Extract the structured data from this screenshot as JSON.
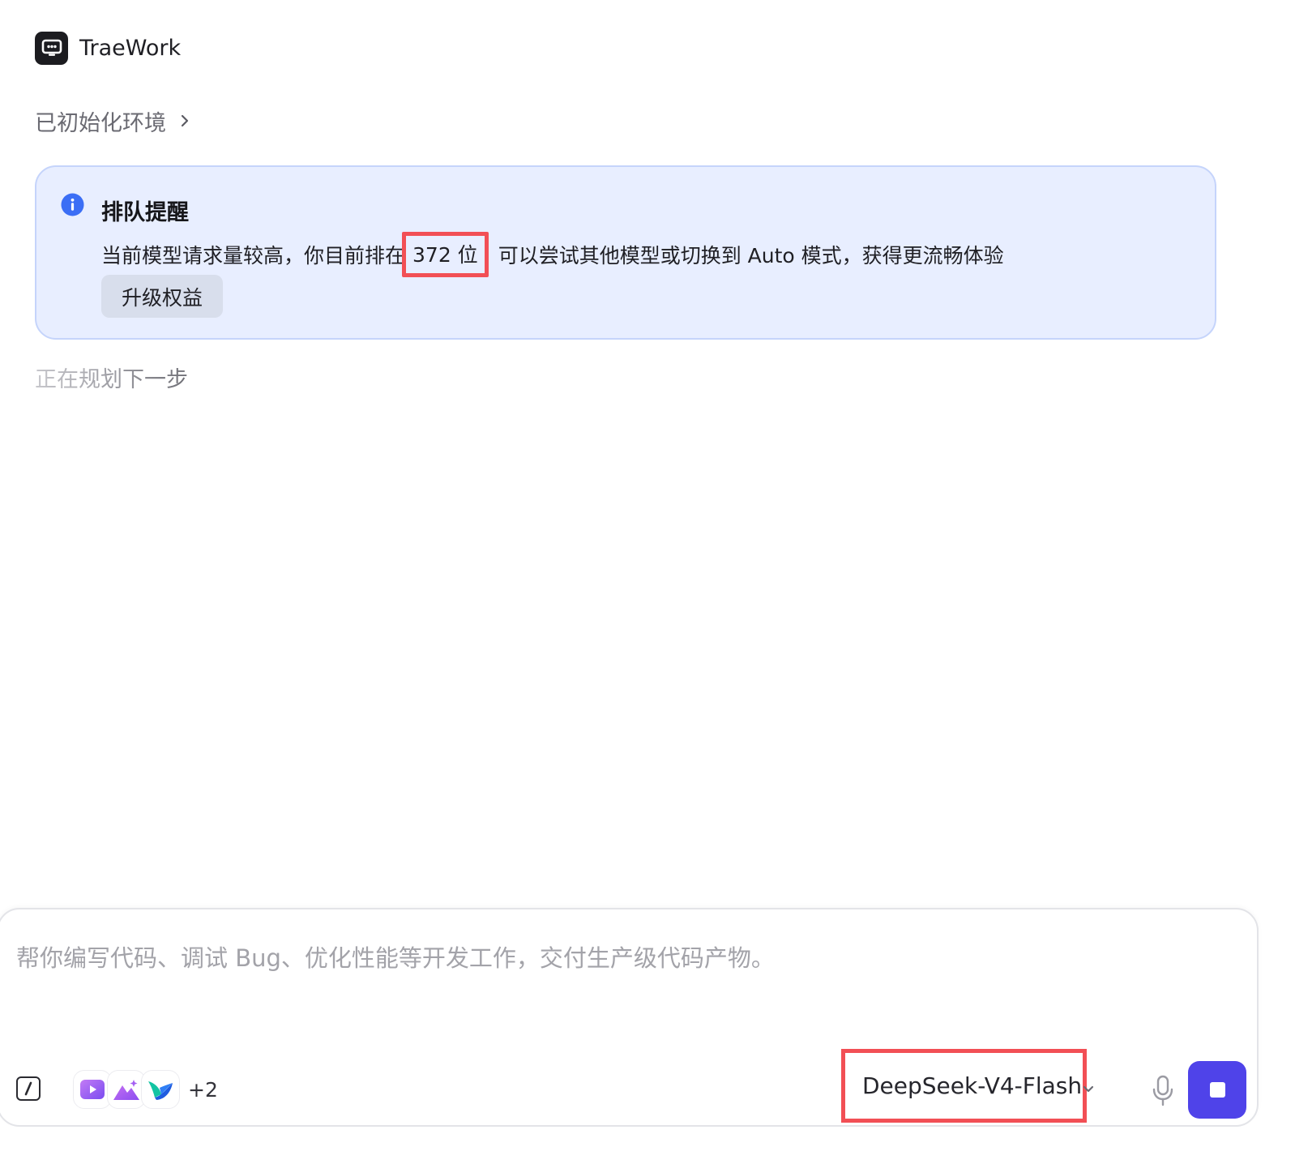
{
  "app": {
    "title": "TraeWork",
    "logo_icon": "robot-screen-icon"
  },
  "environment": {
    "status_label": "已初始化环境",
    "expand_icon": "chevron-right-icon"
  },
  "notice": {
    "icon": "info-icon",
    "title": "排队提醒",
    "message_prefix": "当前模型请求量较高，你目前排在",
    "queue_position": "372 位",
    "message_suffix": "可以尝试其他模型或切换到 Auto 模式，获得更流畅体验",
    "upgrade_label": "升级权益",
    "accent_color": "#3b6ef5"
  },
  "status": {
    "planning_text": "正在规划下一步"
  },
  "composer": {
    "placeholder": "帮你编写代码、调试 Bug、优化性能等开发工作，交付生产级代码产物。",
    "slash_icon": "slash-command-icon",
    "tools": [
      {
        "name": "video-tool-icon"
      },
      {
        "name": "image-generation-icon"
      },
      {
        "name": "bird-app-icon"
      }
    ],
    "more_tools_label": "+2",
    "model_name": "DeepSeek-V4-Flash",
    "model_dropdown_icon": "chevron-down-icon",
    "mic_icon": "microphone-icon",
    "stop_icon": "stop-icon",
    "stop_button_color": "#4f43e9",
    "highlight_color": "#f24f55"
  }
}
